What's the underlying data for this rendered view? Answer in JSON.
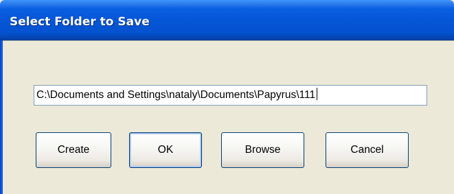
{
  "window": {
    "title": "Select Folder to Save"
  },
  "path_field": {
    "value": "C:\\Documents and Settings\\nataly\\Documents\\Papyrus\\111"
  },
  "buttons": {
    "create": "Create",
    "ok": "OK",
    "browse": "Browse",
    "cancel": "Cancel"
  },
  "colors": {
    "titlebar": "#0556d6",
    "client_background": "#ece9d8",
    "button_border": "#003c74"
  }
}
